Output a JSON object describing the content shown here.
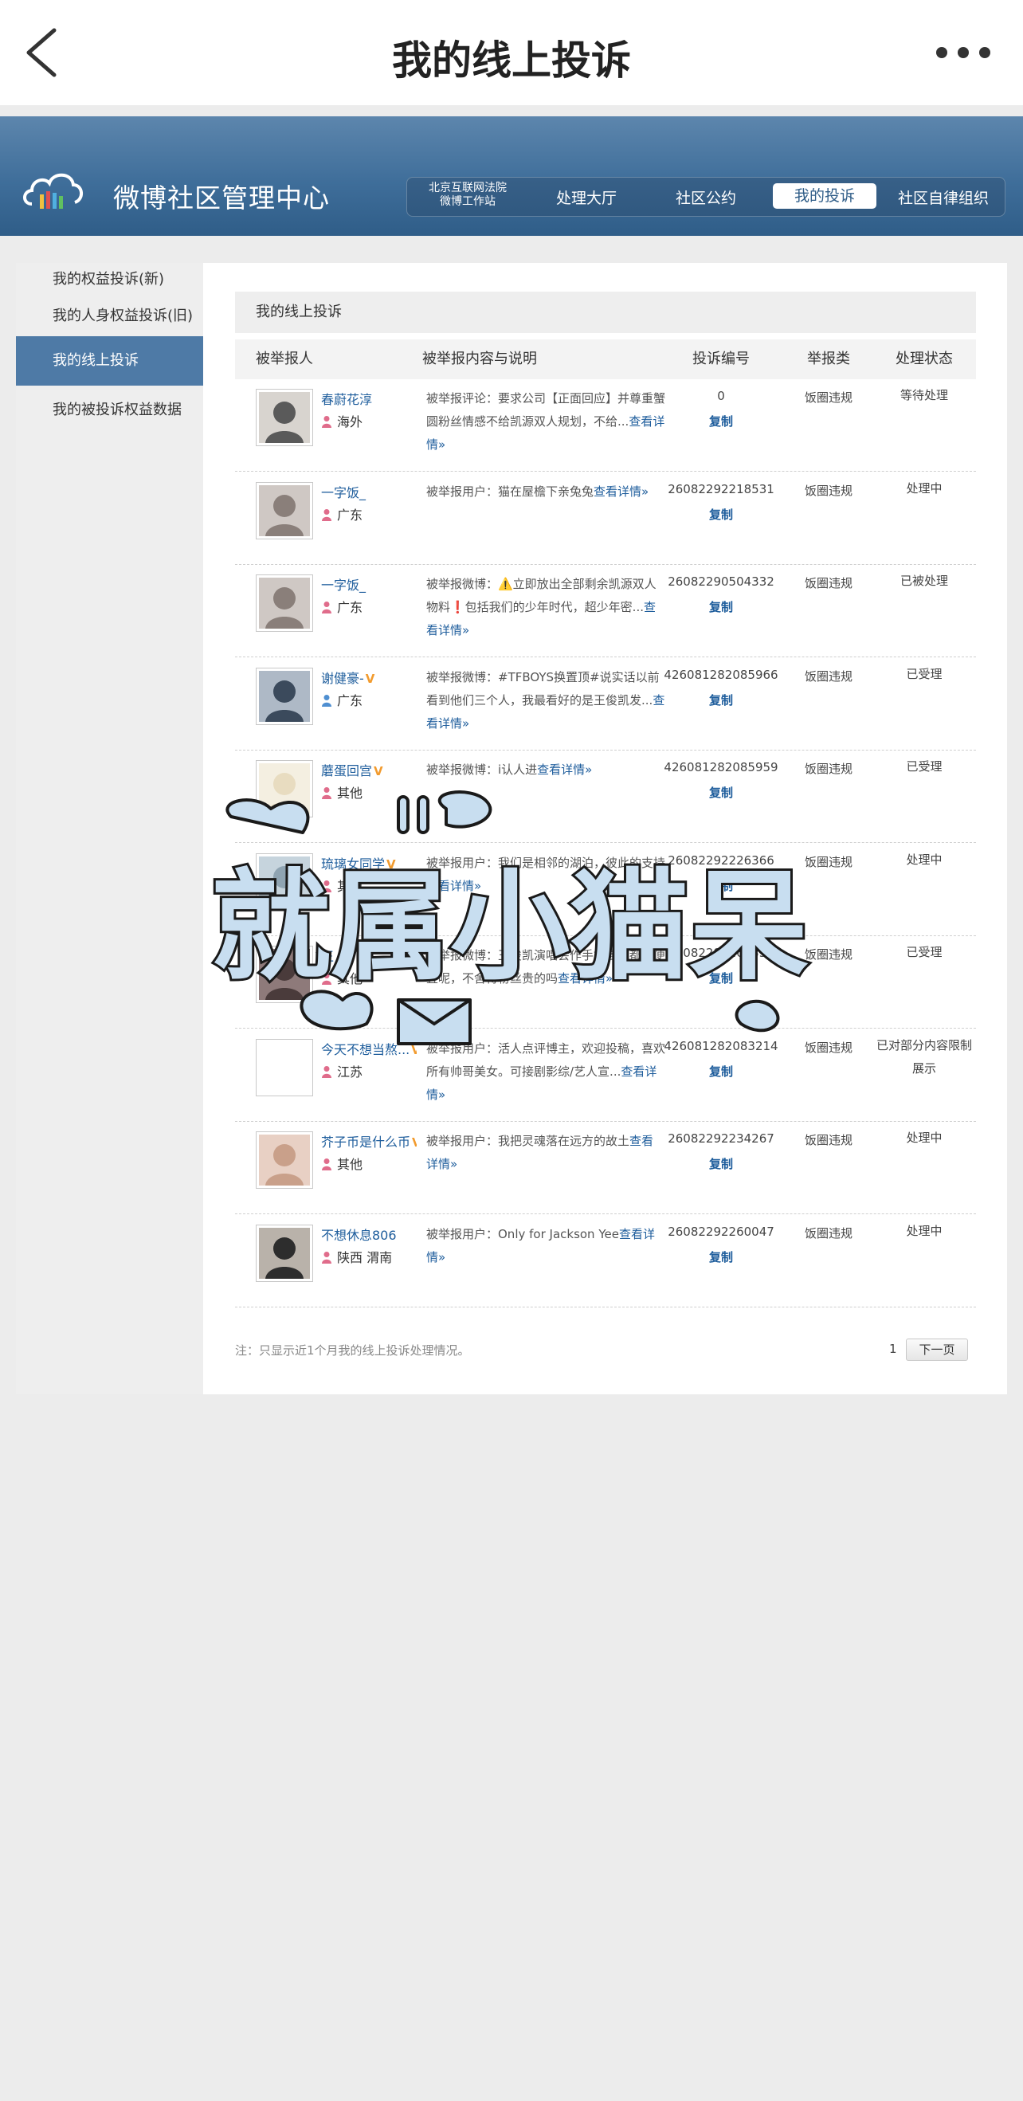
{
  "topbar": {
    "title": "我的线上投诉"
  },
  "banner": {
    "brand": "微博社区管理中心",
    "nav": [
      "北京互联网法院 微博工作站",
      "处理大厅",
      "社区公约",
      "我的投诉",
      "社区自律组织"
    ],
    "nav_first_line1": "北京互联网法院",
    "nav_first_line2": "微博工作站",
    "active_nav": "我的投诉"
  },
  "sidebar": {
    "items": [
      "我的权益投诉(新)",
      "我的人身权益投诉(旧)",
      "我的线上投诉",
      "我的被投诉权益数据"
    ],
    "active": "我的线上投诉"
  },
  "section": {
    "title": "我的线上投诉"
  },
  "columns": [
    "被举报人",
    "被举报内容与说明",
    "投诉编号",
    "举报类",
    "处理状态"
  ],
  "rows": [
    {
      "name": "春蔚花淳",
      "verified": false,
      "location": "海外",
      "gender": "female",
      "content": "被举报评论：要求公司【正面回应】并尊重蟹圆粉丝情感不给凯源双人规划，不给...",
      "more": "查看详情»",
      "id": "0",
      "copy": "复制",
      "type": "饭圈违规",
      "status": "等待处理"
    },
    {
      "name": "一字饭_",
      "verified": false,
      "location": "广东",
      "gender": "female",
      "content": "被举报用户：猫在屋檐下亲兔兔",
      "more": "查看详情»",
      "id": "26082292218531",
      "copy": "复制",
      "type": "饭圈违规",
      "status": "处理中"
    },
    {
      "name": "一字饭_",
      "verified": false,
      "location": "广东",
      "gender": "female",
      "content": "被举报微博：⚠️立即放出全部剩余凯源双人物料❗️包括我们的少年时代，超少年密...",
      "more": "查看详情»",
      "id": "26082290504332",
      "copy": "复制",
      "type": "饭圈违规",
      "status": "已被处理"
    },
    {
      "name": "谢健豪-",
      "verified": true,
      "location": "广东",
      "gender": "male",
      "content": "被举报微博：#TFBOYS换置顶#说实话以前看到他们三个人，我最看好的是王俊凯发...",
      "more": "查看详情»",
      "id": "426081282085966",
      "copy": "复制",
      "type": "饭圈违规",
      "status": "已受理"
    },
    {
      "name": "蘑蛋回宫",
      "verified": true,
      "location": "其他",
      "gender": "female",
      "content": "被举报微博：i认人进",
      "more": "查看详情»",
      "id": "426081282085959",
      "copy": "复制",
      "type": "饭圈违规",
      "status": "已受理"
    },
    {
      "name": "琉璃女同学",
      "verified": true,
      "location": "其他",
      "gender": "female",
      "content": "被举报用户：我们是相邻的湖泊，彼此的支持",
      "more": "查看详情»",
      "id": "26082292226366",
      "copy": "复制",
      "type": "饭圈违规",
      "status": "处理中"
    },
    {
      "name": "王",
      "verified": false,
      "location": "其他",
      "gender": "female",
      "content": "被举报微博：王俊凯演唱会作手机看看都好便宜呢，不舍得粉丝贵的吗",
      "more": "查看详情»",
      "id": "26082292260353",
      "copy": "复制",
      "type": "饭圈违规",
      "status": "已受理"
    },
    {
      "name": "今天不想当熬...",
      "verified": true,
      "location": "江苏",
      "gender": "female",
      "content": "被举报用户：活人点评博主，欢迎投稿，喜欢所有帅哥美女。可接剧影综/艺人宣...",
      "more": "查看详情»",
      "id": "426081282083214",
      "copy": "复制",
      "type": "饭圈违规",
      "status": "已对部分内容限制展示"
    },
    {
      "name": "芥子币是什么币",
      "verified": true,
      "location": "其他",
      "gender": "female",
      "content": "被举报用户：我把灵魂落在远方的故土",
      "more": "查看详情»",
      "id": "26082292234267",
      "copy": "复制",
      "type": "饭圈违规",
      "status": "处理中"
    },
    {
      "name": "不想休息806",
      "verified": false,
      "location": "陕西 渭南",
      "gender": "female",
      "content": "被举报用户：Only for Jackson Yee",
      "more": "查看详情»",
      "id": "26082292260047",
      "copy": "复制",
      "type": "饭圈违规",
      "status": "处理中"
    }
  ],
  "footer": {
    "note": "注：只显示近1个月我的线上投诉处理情况。",
    "page": "1",
    "next": "下一页"
  },
  "sticker": {
    "text": "就属小猫呆"
  },
  "colors": {
    "banner": "#3f6e9a",
    "link": "#1e5d9c",
    "active_side": "#4e7aa6",
    "verified": "#f29b2e"
  }
}
